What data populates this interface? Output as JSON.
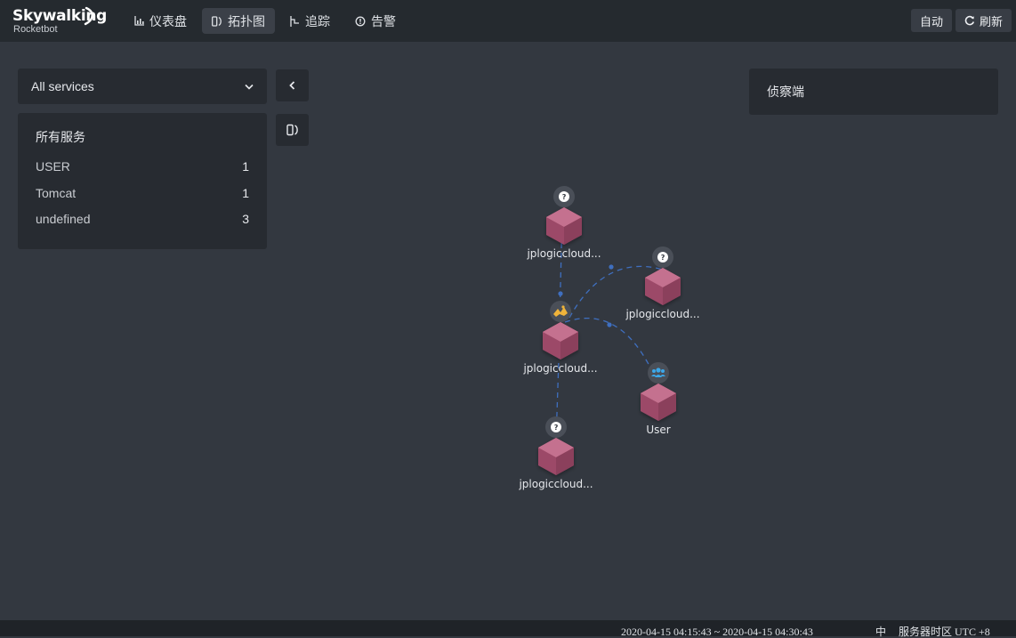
{
  "header": {
    "logo_title": "Skywalking",
    "logo_subtitle": "Rocketbot",
    "nav": [
      {
        "label": "仪表盘",
        "icon": "dashboard-icon",
        "active": false
      },
      {
        "label": "拓扑图",
        "icon": "topology-icon",
        "active": true
      },
      {
        "label": "追踪",
        "icon": "trace-icon",
        "active": false
      },
      {
        "label": "告警",
        "icon": "alarm-icon",
        "active": false
      }
    ],
    "auto_label": "自动",
    "refresh_label": "刷新",
    "refresh_icon": "refresh-icon"
  },
  "sidebar": {
    "service_select": "All services",
    "services_title": "所有服务",
    "services": [
      {
        "name": "USER",
        "count": "1"
      },
      {
        "name": "Tomcat",
        "count": "1"
      },
      {
        "name": "undefined",
        "count": "3"
      }
    ],
    "collapse_icon": "chevron-left-icon",
    "topology_toggle_icon": "topology-icon"
  },
  "probe_panel": {
    "title": "侦察端"
  },
  "topology": {
    "node_color": "#b05a78",
    "edge_color": "#3f6fbf",
    "nodes": [
      {
        "id": "n1",
        "label": "jplogiccloud...",
        "type": "unknown"
      },
      {
        "id": "n2",
        "label": "jplogiccloud...",
        "type": "unknown"
      },
      {
        "id": "n3",
        "label": "jplogiccloud...",
        "type": "tomcat"
      },
      {
        "id": "n4",
        "label": "User",
        "type": "user"
      },
      {
        "id": "n5",
        "label": "jplogiccloud...",
        "type": "unknown"
      }
    ]
  },
  "footer": {
    "time_range": "2020-04-15 04:15:43 ~ 2020-04-15 04:30:43",
    "language": "中",
    "timezone": "服务器时区 UTC +8"
  }
}
